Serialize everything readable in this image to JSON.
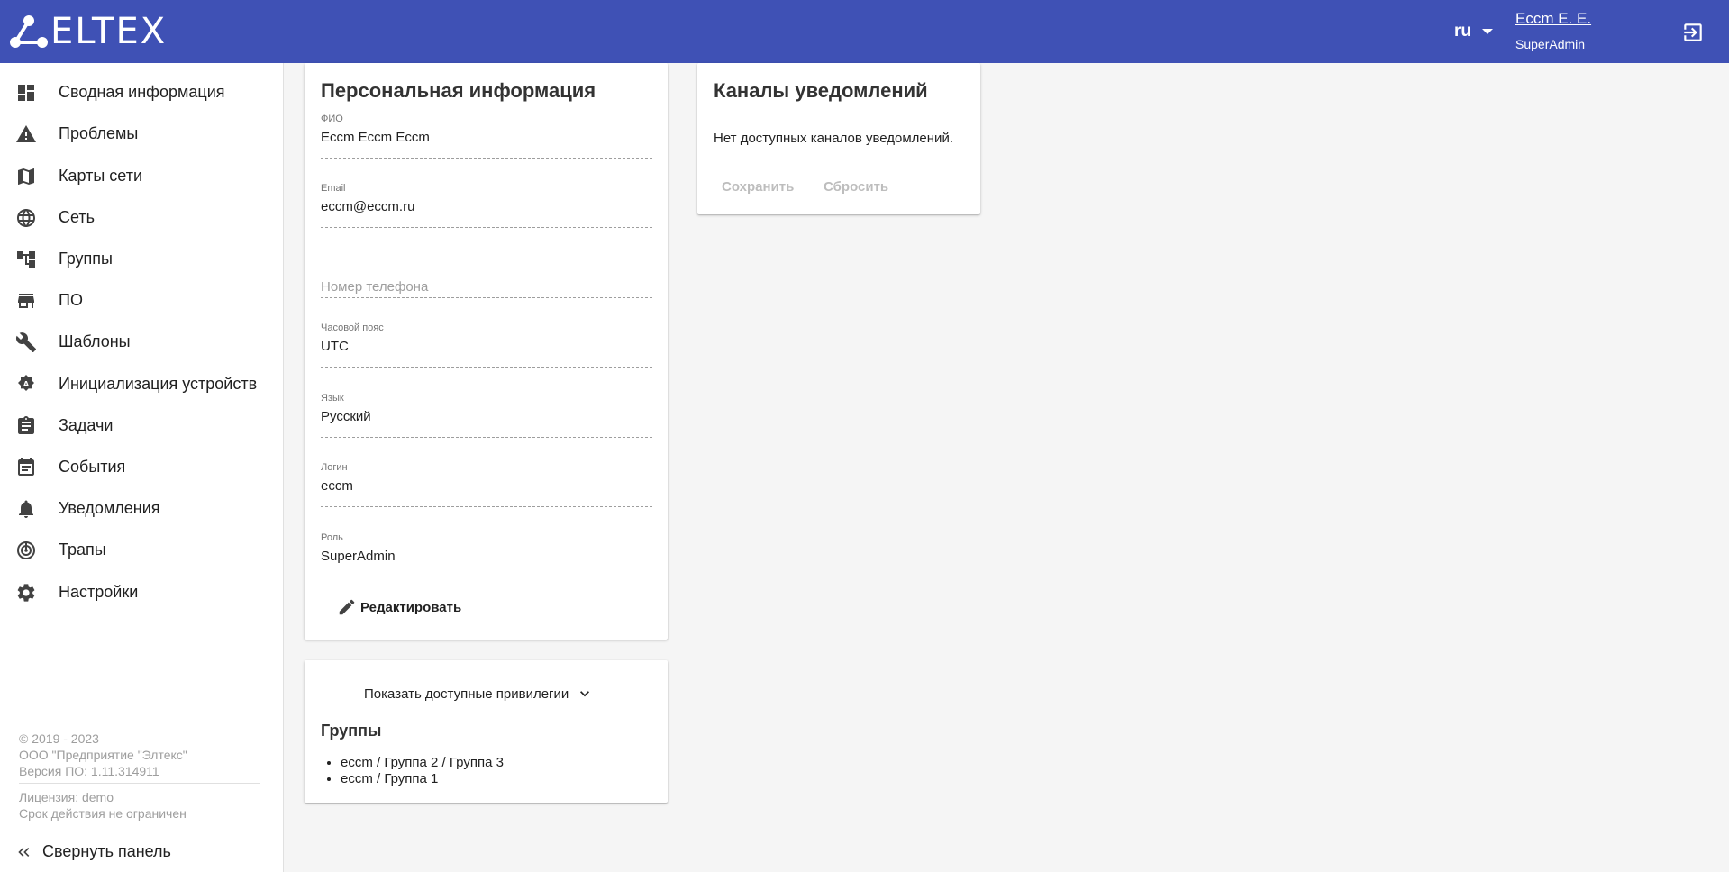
{
  "header": {
    "logo_text": "ELTEX",
    "brand_color": "#3f51b5",
    "language": "ru",
    "user_name": "Eccm E. E.",
    "user_role": "SuperAdmin"
  },
  "sidebar": {
    "items": [
      {
        "label": "Сводная информация",
        "icon": "dashboard-icon"
      },
      {
        "label": "Проблемы",
        "icon": "warning-icon"
      },
      {
        "label": "Карты сети",
        "icon": "map-icon"
      },
      {
        "label": "Сеть",
        "icon": "globe-icon"
      },
      {
        "label": "Группы",
        "icon": "hierarchy-icon"
      },
      {
        "label": "ПО",
        "icon": "store-icon"
      },
      {
        "label": "Шаблоны",
        "icon": "wrench-icon"
      },
      {
        "label": "Инициализация устройств",
        "icon": "auto-init-icon"
      },
      {
        "label": "Задачи",
        "icon": "clipboard-icon"
      },
      {
        "label": "События",
        "icon": "calendar-icon"
      },
      {
        "label": "Уведомления",
        "icon": "bell-icon"
      },
      {
        "label": "Трапы",
        "icon": "radar-icon"
      },
      {
        "label": "Настройки",
        "icon": "gear-icon"
      }
    ],
    "copyright": "© 2019 - 2023",
    "company": "ООО \"Предприятие \"Элтекс\"",
    "version": "Версия ПО: 1.11.314911",
    "license": "Лицензия: demo",
    "expiry": "Срок действия не ограничен",
    "collapse_label": "Свернуть панель"
  },
  "personal": {
    "title": "Персональная информация",
    "fields": [
      {
        "label": "ФИО",
        "value": "Eccm Eccm Eccm"
      },
      {
        "label": "Email",
        "value": "eccm@eccm.ru"
      },
      {
        "label": "",
        "value": "",
        "placeholder": "Номер телефона"
      },
      {
        "label": "Часовой пояс",
        "value": "UTC"
      },
      {
        "label": "Язык",
        "value": "Русский"
      },
      {
        "label": "Логин",
        "value": "eccm"
      },
      {
        "label": "Роль",
        "value": "SuperAdmin"
      }
    ],
    "edit_label": "Редактировать"
  },
  "privileges": {
    "toggle_label": "Показать доступные привилегии",
    "groups_title": "Группы",
    "groups": [
      "eccm / Группа 2 / Группа 3",
      "eccm / Группа 1"
    ]
  },
  "notifications": {
    "title": "Каналы уведомлений",
    "empty_text": "Нет доступных каналов уведомлений.",
    "save_label": "Сохранить",
    "reset_label": "Сбросить"
  }
}
